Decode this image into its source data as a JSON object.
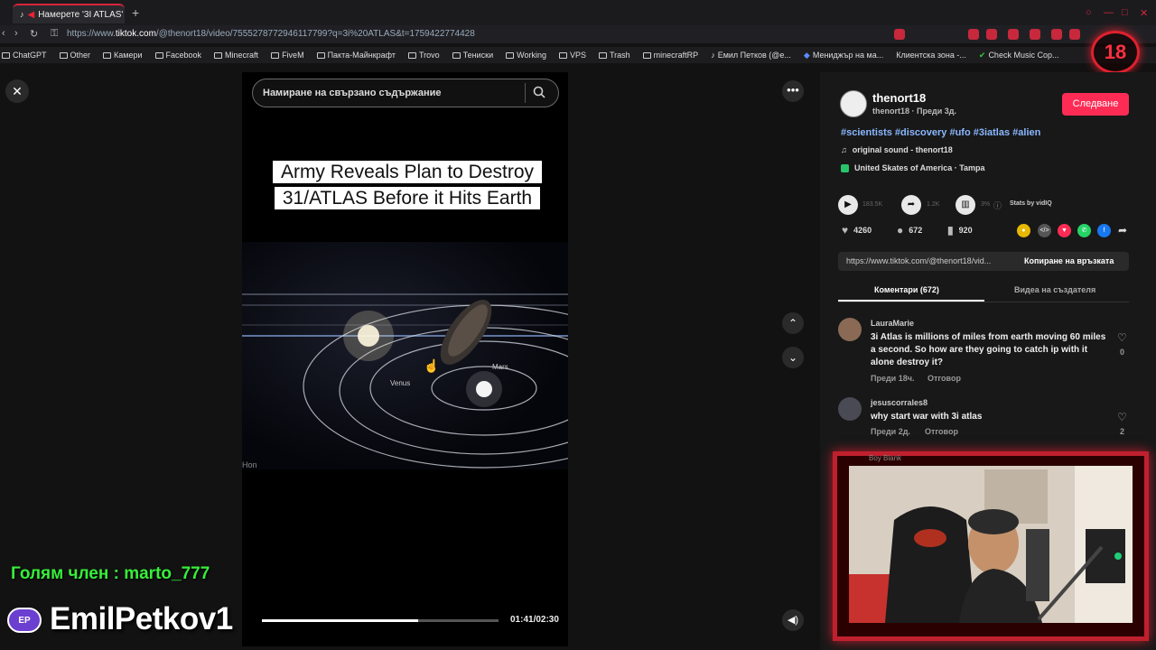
{
  "browser": {
    "tab_title": "Намерете '3I ATLAS' в",
    "url_prefix": "https://www.",
    "url_domain": "tiktok.com",
    "url_rest": "/@thenort18/video/7555278772946117799?q=3i%20ATLAS&t=1759422774428",
    "bookmarks": [
      "ChatGPT",
      "Other",
      "Камери",
      "Facebook",
      "Minecraft",
      "FiveM",
      "Пакта-Майнкрафт",
      "Trovo",
      "Тениски",
      "Working",
      "VPS",
      "Trash",
      "minecraftRP",
      "Емил Петков (@e...",
      "Мениджър на ма...",
      "Клиентска зона -...",
      "Check Music Cop..."
    ],
    "age_badge": "18"
  },
  "video": {
    "search_placeholder": "Намиране на свързано съдържание",
    "caption": "Army Reveals Plan to Destroy 31/ATLAS Before it Hits Earth",
    "label_venus": "Venus",
    "label_mars": "Mars",
    "watermark": "Hon",
    "time": "01:41/02:30",
    "progress_fraction": 0.66
  },
  "post": {
    "username": "thenort18",
    "user_meta": "thenort18 · Преди 3д.",
    "follow": "Следване",
    "hashtags": "#scientists #discovery #ufo #3iatlas #alien",
    "sound": "original sound - thenort18",
    "location": "United Skates of America · Tampa",
    "stat_views": "183.5K",
    "stat_shares": "1.2K",
    "stat_pct": "3%",
    "stats_by": "Stats by vidIQ",
    "likes": "4260",
    "comments": "672",
    "saves": "920",
    "link": "https://www.tiktok.com/@thenort18/vid...",
    "copy_link": "Копиране на връзката",
    "tab_comments": "Коментари (672)",
    "tab_creator_videos": "Видеа на създателя"
  },
  "comments": [
    {
      "user": "LauraMarie",
      "text": "3i Atlas is millions of miles from earth moving 60 miles a second. So how are they going to catch ip with it alone destroy it?",
      "time": "Преди 18ч.",
      "reply": "Отговор",
      "likes": "0"
    },
    {
      "user": "jesuscorrales8",
      "text": "why start war with 3i atlas",
      "time": "Преди 2д.",
      "reply": "Отговор",
      "likes": "2"
    }
  ],
  "webcam": {
    "peek_user": "Boy Blank"
  },
  "stream": {
    "chat_member": "Голям член : marto_777",
    "streamer": "EmilPetkov1"
  },
  "colors": {
    "accent": "#fe2c55",
    "overlay_red": "#c0202e",
    "chat_green": "#37ef3a"
  }
}
